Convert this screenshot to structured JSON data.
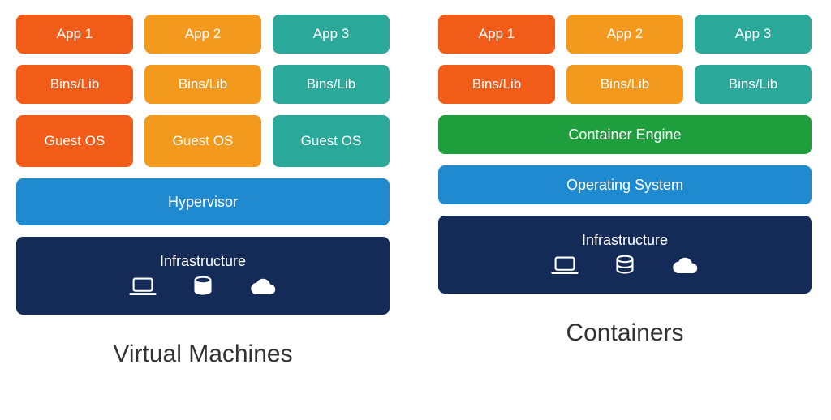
{
  "vm": {
    "apps": [
      "App 1",
      "App 2",
      "App 3"
    ],
    "bins": [
      "Bins/Lib",
      "Bins/Lib",
      "Bins/Lib"
    ],
    "guest": [
      "Guest OS",
      "Guest OS",
      "Guest OS"
    ],
    "hypervisor": "Hypervisor",
    "infra": "Infrastructure",
    "title": "Virtual Machines"
  },
  "ct": {
    "apps": [
      "App 1",
      "App 2",
      "App 3"
    ],
    "bins": [
      "Bins/Lib",
      "Bins/Lib",
      "Bins/Lib"
    ],
    "engine": "Container Engine",
    "os": "Operating System",
    "infra": "Infrastructure",
    "title": "Containers"
  },
  "colors": {
    "col1": "#f25c19",
    "col2": "#f39a1e",
    "col3": "#2aa89a",
    "engine": "#1f9e3d",
    "os_hypervisor": "#1f8ad0",
    "infra": "#142b58"
  },
  "icons": [
    "laptop",
    "database",
    "cloud"
  ]
}
